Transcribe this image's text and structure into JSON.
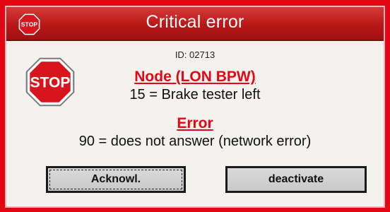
{
  "window": {
    "title": "Critical error",
    "title_icon": "stop-sign-icon",
    "colors": {
      "frame": "#e30613",
      "title_bar": "#b81717",
      "heading_text": "#e30613",
      "background": "#f4f2ee",
      "button": "#cfcfcf"
    }
  },
  "message": {
    "id_text": "ID: 02713",
    "icon": "stop-sign-icon",
    "icon_label": "STOP",
    "title_icon_label": "STOP",
    "node_heading": "Node (LON BPW)",
    "node_value": "15 = Brake tester left",
    "error_heading": "Error",
    "error_value": "90 = does not answer (network error)"
  },
  "buttons": {
    "acknowledge_label": "Acknowl.",
    "deactivate_label": "deactivate"
  }
}
